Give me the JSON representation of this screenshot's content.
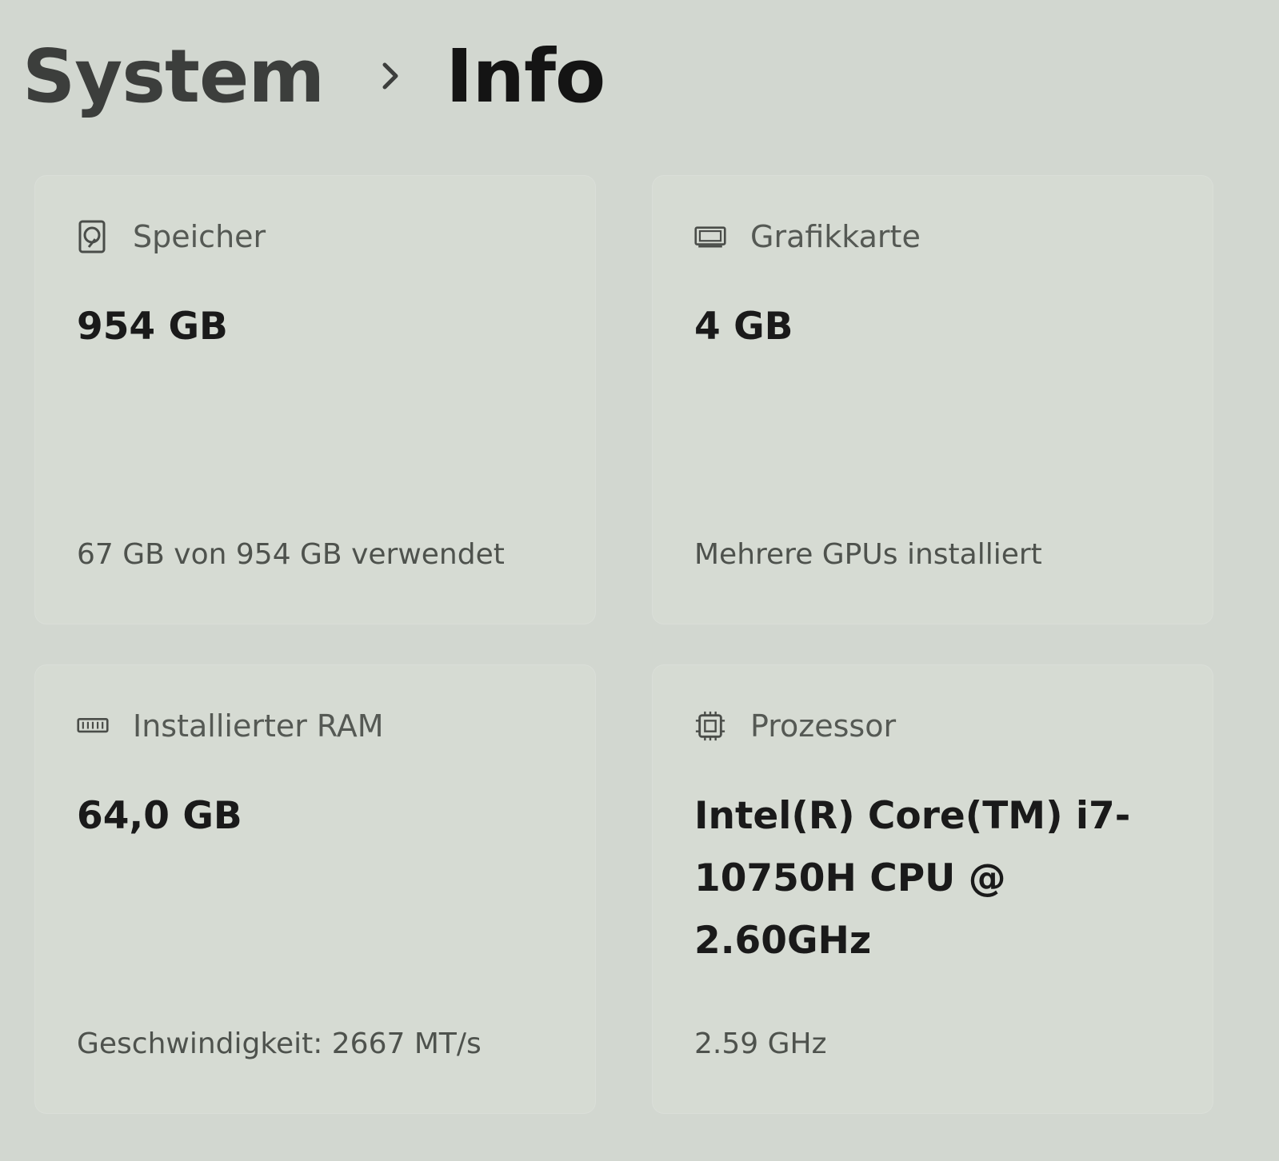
{
  "breadcrumb": {
    "parent": "System",
    "current": "Info"
  },
  "cards": [
    {
      "title": "Speicher",
      "value": "954 GB",
      "detail": "67 GB von 954 GB verwendet",
      "icon": "storage-icon"
    },
    {
      "title": "Grafikkarte",
      "value": "4 GB",
      "detail": "Mehrere GPUs installiert",
      "icon": "graphics-card-icon"
    },
    {
      "title": "Installierter RAM",
      "value": "64,0 GB",
      "detail": "Geschwindigkeit: 2667 MT/s",
      "icon": "memory-icon"
    },
    {
      "title": "Prozessor",
      "value": "Intel(R) Core(TM) i7-10750H CPU @ 2.60GHz",
      "detail": "2.59 GHz",
      "icon": "processor-icon"
    }
  ],
  "colors": {
    "background": "#d2d7d0",
    "card": "#d6dbd3",
    "text_primary": "#1a1a1a",
    "text_secondary": "#555954"
  }
}
